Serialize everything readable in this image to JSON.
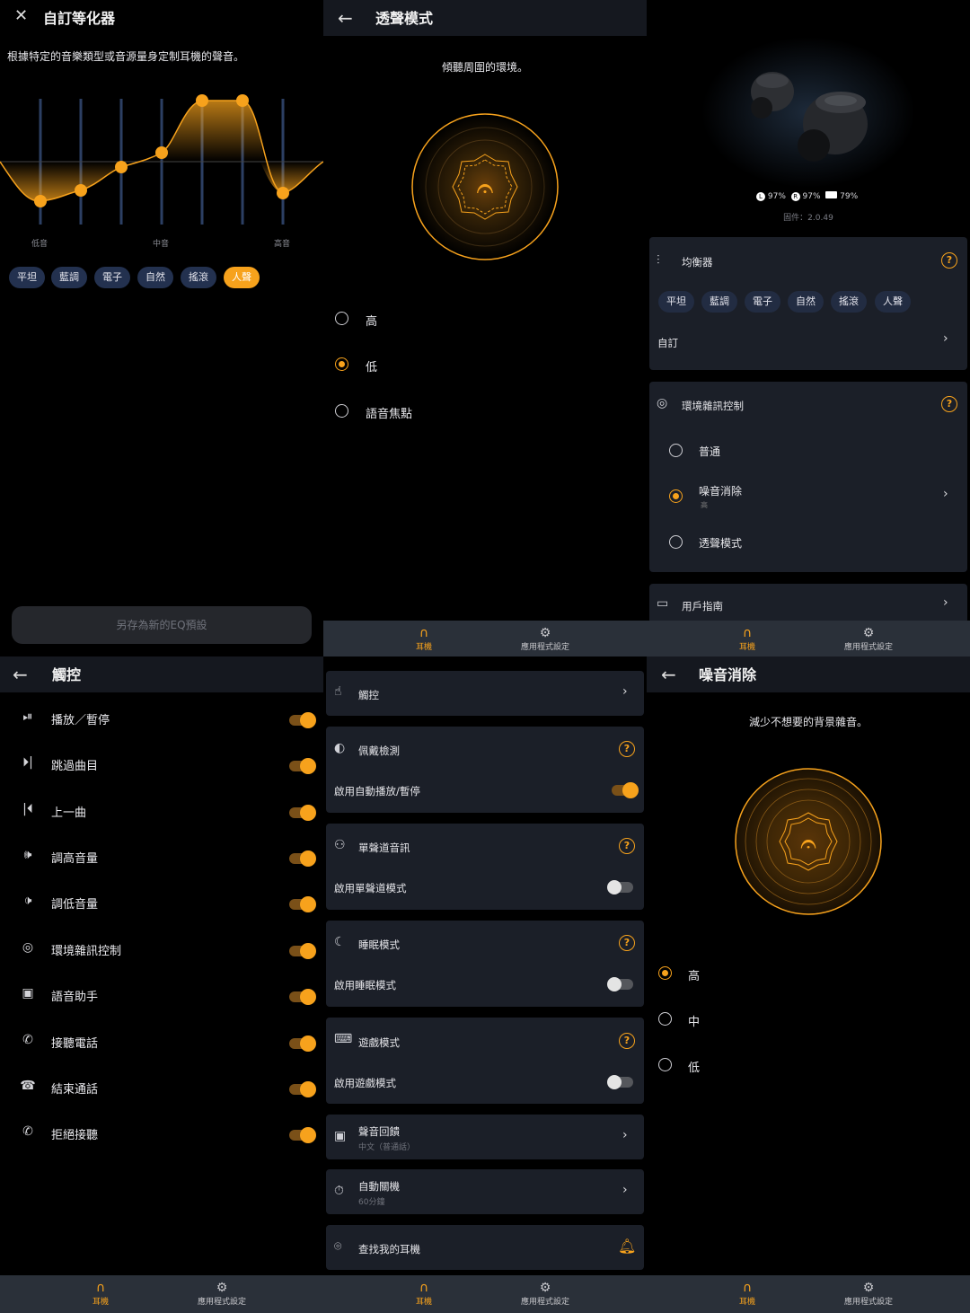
{
  "eq_panel": {
    "title": "自訂等化器",
    "description": "根據特定的音樂類型或音源量身定制耳機的聲音。",
    "band_labels": [
      "低音",
      "中音",
      "高音"
    ],
    "presets": [
      "平坦",
      "藍調",
      "電子",
      "自然",
      "搖滾",
      "人聲"
    ],
    "active_preset": "人聲",
    "save_button": "另存為新的EQ預設"
  },
  "transparency_panel": {
    "title": "透聲模式",
    "description": "傾聽周圍的環境。",
    "options": [
      "高",
      "低",
      "語音焦點"
    ],
    "selected": "低"
  },
  "device_panel": {
    "battery": [
      {
        "side": "L",
        "value": "97%"
      },
      {
        "side": "R",
        "value": "97%"
      },
      {
        "side": "case",
        "value": "79%"
      }
    ],
    "firmware": "固件：2.0.49",
    "equalizer": {
      "title": "均衡器",
      "presets": [
        "平坦",
        "藍調",
        "電子",
        "自然",
        "搖滾",
        "人聲"
      ],
      "custom": "自訂"
    },
    "anc": {
      "title": "環境雜訊控制",
      "options": [
        {
          "label": "普通",
          "sub": ""
        },
        {
          "label": "噪音消除",
          "sub": "高"
        },
        {
          "label": "透聲模式",
          "sub": ""
        }
      ],
      "selected": "噪音消除"
    },
    "guide": "用戶指南"
  },
  "touch_panel": {
    "title": "觸控",
    "items": [
      {
        "icon": "play-pause-icon",
        "label": "播放／暫停",
        "on": true
      },
      {
        "icon": "skip-icon",
        "label": "跳過曲目",
        "on": true
      },
      {
        "icon": "previous-icon",
        "label": "上一曲",
        "on": true
      },
      {
        "icon": "volume-up-icon",
        "label": "調高音量",
        "on": true
      },
      {
        "icon": "volume-down-icon",
        "label": "調低音量",
        "on": true
      },
      {
        "icon": "ambient-icon",
        "label": "環境雜訊控制",
        "on": true
      },
      {
        "icon": "assistant-icon",
        "label": "語音助手",
        "on": true
      },
      {
        "icon": "phone-answer-icon",
        "label": "接聽電話",
        "on": true
      },
      {
        "icon": "phone-hangup-icon",
        "label": "結束通話",
        "on": true
      },
      {
        "icon": "phone-reject-icon",
        "label": "拒絕接聽",
        "on": true
      }
    ]
  },
  "settings_panel": {
    "touch": "觸控",
    "wear_detect": {
      "title": "佩戴檢測",
      "toggle_label": "啟用自動播放/暫停",
      "on": true
    },
    "mono": {
      "title": "單聲道音訊",
      "toggle_label": "啟用單聲道模式",
      "on": false
    },
    "sleep": {
      "title": "睡眠模式",
      "toggle_label": "啟用睡眠模式",
      "on": false
    },
    "game": {
      "title": "遊戲模式",
      "toggle_label": "啟用遊戲模式",
      "on": false
    },
    "voice_prompt": {
      "title": "聲音回饋",
      "sub": "中文（普通話）"
    },
    "auto_off": {
      "title": "自動關機",
      "sub": "60分鐘"
    },
    "find": "查找我的耳機"
  },
  "nc_panel": {
    "title": "噪音消除",
    "description": "減少不想要的背景雜音。",
    "options": [
      "高",
      "中",
      "低"
    ],
    "selected": "高"
  },
  "nav": {
    "headphones": "耳機",
    "app_settings": "應用程式設定"
  },
  "colors": {
    "accent": "#f7a21c",
    "card": "#1b1f28",
    "header": "#15181f",
    "chip": "#23314f",
    "navbar": "#2a3039"
  }
}
